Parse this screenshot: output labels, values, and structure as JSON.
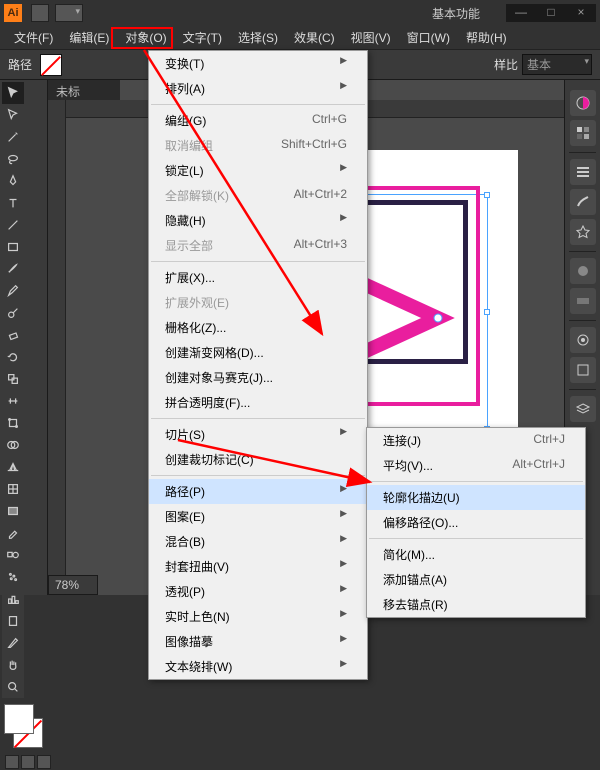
{
  "title_workspace": "基本功能",
  "window_buttons": {
    "min": "—",
    "max": "□",
    "close": "×"
  },
  "menubar": [
    "文件(F)",
    "编辑(E)",
    "对象(O)",
    "文字(T)",
    "选择(S)",
    "效果(C)",
    "视图(V)",
    "窗口(W)",
    "帮助(H)"
  ],
  "optionbar": {
    "label": "路径",
    "pct": "样比",
    "style": "基本"
  },
  "doc_tab": "未标",
  "zoom": "78%",
  "dropdown1": [
    {
      "l": "变换(T)",
      "sub": true
    },
    {
      "l": "排列(A)",
      "sub": true
    },
    {
      "sep": true
    },
    {
      "l": "编组(G)",
      "sc": "Ctrl+G"
    },
    {
      "l": "取消编组",
      "sc": "Shift+Ctrl+G",
      "dis": true
    },
    {
      "l": "锁定(L)",
      "sub": true
    },
    {
      "l": "全部解锁(K)",
      "sc": "Alt+Ctrl+2",
      "dis": true
    },
    {
      "l": "隐藏(H)",
      "sub": true
    },
    {
      "l": "显示全部",
      "sc": "Alt+Ctrl+3",
      "dis": true
    },
    {
      "sep": true
    },
    {
      "l": "扩展(X)..."
    },
    {
      "l": "扩展外观(E)",
      "dis": true
    },
    {
      "l": "栅格化(Z)..."
    },
    {
      "l": "创建渐变网格(D)..."
    },
    {
      "l": "创建对象马赛克(J)..."
    },
    {
      "l": "拼合透明度(F)..."
    },
    {
      "sep": true
    },
    {
      "l": "切片(S)",
      "sub": true
    },
    {
      "l": "创建裁切标记(C)"
    },
    {
      "sep": true
    },
    {
      "l": "路径(P)",
      "sub": true,
      "hl": true
    },
    {
      "l": "图案(E)",
      "sub": true
    },
    {
      "l": "混合(B)",
      "sub": true
    },
    {
      "l": "封套扭曲(V)",
      "sub": true
    },
    {
      "l": "透视(P)",
      "sub": true
    },
    {
      "l": "实时上色(N)",
      "sub": true
    },
    {
      "l": "图像描摹",
      "sub": true
    },
    {
      "l": "文本绕排(W)",
      "sub": true
    }
  ],
  "dropdown2": [
    {
      "l": "连接(J)",
      "sc": "Ctrl+J"
    },
    {
      "l": "平均(V)...",
      "sc": "Alt+Ctrl+J"
    },
    {
      "sep": true
    },
    {
      "l": "轮廓化描边(U)",
      "hl": true
    },
    {
      "l": "偏移路径(O)..."
    },
    {
      "sep": true
    },
    {
      "l": "简化(M)..."
    },
    {
      "l": "添加锚点(A)"
    },
    {
      "l": "移去锚点(R)"
    }
  ]
}
